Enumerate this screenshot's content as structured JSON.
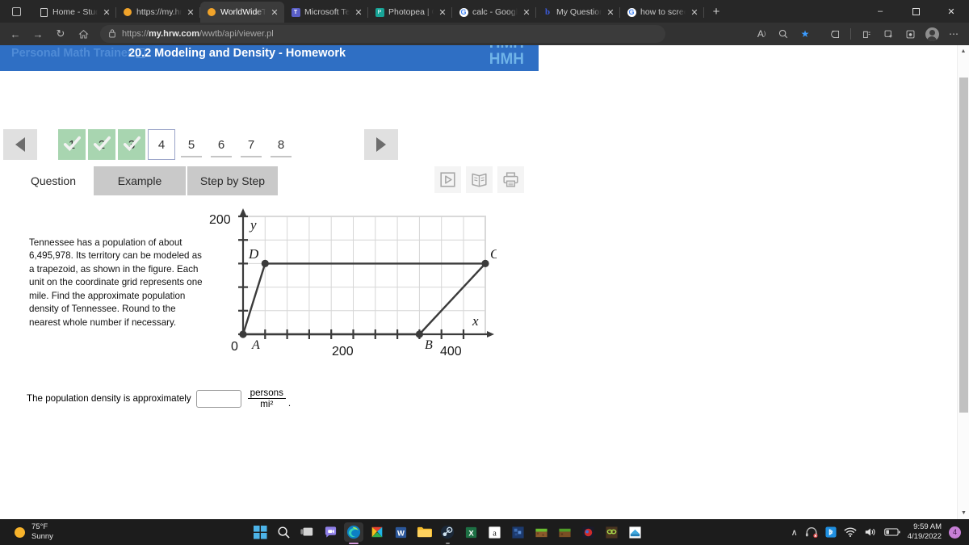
{
  "browser": {
    "tabs": [
      {
        "label": "Home - Student P",
        "icon": "page-icon",
        "active": false
      },
      {
        "label": "https://my.hrw.co",
        "icon": "orange-dot-icon",
        "active": false
      },
      {
        "label": "WorldWideTestba",
        "icon": "orange-dot-icon",
        "active": true
      },
      {
        "label": "Microsoft Teams",
        "icon": "teams-icon",
        "active": false
      },
      {
        "label": "Photopea | Online",
        "icon": "photopea-icon",
        "active": false
      },
      {
        "label": "calc - Google Sea",
        "icon": "google-icon",
        "active": false
      },
      {
        "label": "My Questions | ba",
        "icon": "brainly-icon",
        "active": false
      },
      {
        "label": "how to screensho",
        "icon": "google-icon",
        "active": false
      }
    ],
    "new_tab_label": "+",
    "window_controls": {
      "minimize": "–",
      "maximize": "❐",
      "close": "✕"
    },
    "nav": {
      "back": "←",
      "forward": "→",
      "refresh": "↻",
      "home": "⌂",
      "lock_icon": "lock-icon"
    },
    "url": {
      "prefix": "https://",
      "domain": "my.hrw.com",
      "path": "/wwtb/api/viewer.pl",
      "full": "https://my.hrw.com/wwtb/api/viewer.pl"
    },
    "toolbar_right": [
      "read-aloud-icon",
      "zoom-icon",
      "favorite-star-icon",
      "split-screen-icon",
      "collections-icon",
      "add-to-collections-icon",
      "browser-essentials-icon",
      "profile-avatar",
      "settings-more-icon"
    ]
  },
  "app": {
    "brand_left": "Personal Math Trainer",
    "title": "20.2 Modeling and Density - Homework",
    "logo_top": "HMH",
    "logo": "HMH"
  },
  "pager": {
    "prev_label": "◀",
    "next_label": "▶",
    "questions": [
      {
        "num": "1",
        "state": "done"
      },
      {
        "num": "2",
        "state": "done"
      },
      {
        "num": "3",
        "state": "done"
      },
      {
        "num": "4",
        "state": "current"
      },
      {
        "num": "5",
        "state": "plain"
      },
      {
        "num": "6",
        "state": "plain"
      },
      {
        "num": "7",
        "state": "plain"
      },
      {
        "num": "8",
        "state": "plain"
      }
    ]
  },
  "tabs": {
    "question": "Question",
    "example": "Example",
    "step_by_step": "Step by Step"
  },
  "tools": {
    "video": "video-play-icon",
    "textbook": "textbook-icon",
    "print": "printer-icon"
  },
  "problem": {
    "text": "Tennessee has a population of about 6,495,978. Its territory can be modeled as a trapezoid, as shown in the figure. Each unit on the coordinate grid represents one mile. Find the approximate population density of Tennessee. Round to the nearest whole number if necessary."
  },
  "answer": {
    "prompt": "The population density is approximately",
    "value": "",
    "placeholder": "",
    "unit_numerator": "persons",
    "unit_denominator": "mi²",
    "period": "."
  },
  "chart_data": {
    "type": "scatter",
    "title": "",
    "xlabel": "x",
    "ylabel": "y",
    "xlim": [
      0,
      440
    ],
    "ylim": [
      0,
      200
    ],
    "grid": true,
    "x_ticks": [
      0,
      40,
      80,
      120,
      160,
      200,
      240,
      280,
      320,
      360,
      400,
      440
    ],
    "y_ticks": [
      0,
      40,
      80,
      120,
      160,
      200
    ],
    "x_tick_labels": [
      {
        "value": 0,
        "label": "0"
      },
      {
        "value": 200,
        "label": "200"
      },
      {
        "value": 400,
        "label": "400"
      }
    ],
    "y_tick_labels": [
      {
        "value": 200,
        "label": "200"
      }
    ],
    "points": [
      {
        "name": "A",
        "x": 0,
        "y": 0,
        "label_pos": "below-right"
      },
      {
        "name": "B",
        "x": 320,
        "y": 0,
        "label_pos": "below-right"
      },
      {
        "name": "C",
        "x": 440,
        "y": 120,
        "label_pos": "above-right"
      },
      {
        "name": "D",
        "x": 40,
        "y": 120,
        "label_pos": "above-left"
      }
    ],
    "shape": "trapezoid",
    "edges": [
      [
        "A",
        "D"
      ],
      [
        "D",
        "C"
      ],
      [
        "C",
        "B"
      ],
      [
        "B",
        "A"
      ]
    ],
    "origin_label": "0",
    "annotations": [
      "A",
      "B",
      "C",
      "D",
      "x",
      "y",
      "0",
      "200",
      "400",
      "200"
    ]
  },
  "taskbar": {
    "weather": {
      "temp": "75°F",
      "condition": "Sunny",
      "icon": "sun-icon"
    },
    "apps": [
      {
        "name": "start-button",
        "icon": "windows-logo-icon"
      },
      {
        "name": "search-button",
        "icon": "search-icon"
      },
      {
        "name": "task-view-button",
        "icon": "task-view-icon"
      },
      {
        "name": "chat-button",
        "icon": "teams-chat-icon"
      },
      {
        "name": "edge-button",
        "icon": "edge-icon"
      },
      {
        "name": "photos-button",
        "icon": "photos-icon"
      },
      {
        "name": "word-button",
        "icon": "word-icon"
      },
      {
        "name": "file-explorer-button",
        "icon": "folder-icon"
      },
      {
        "name": "steam-button",
        "icon": "steam-icon"
      },
      {
        "name": "excel-button",
        "icon": "excel-icon"
      },
      {
        "name": "amazon-button",
        "icon": "amazon-icon"
      },
      {
        "name": "minecraft-launcher-button",
        "icon": "minecraft-portal-icon"
      },
      {
        "name": "minecraft-button",
        "icon": "grass-block-icon"
      },
      {
        "name": "minecraft-2-button",
        "icon": "grass-block-icon"
      },
      {
        "name": "badlion-button",
        "icon": "badlion-icon"
      },
      {
        "name": "lunar-client-button",
        "icon": "lunar-icon"
      },
      {
        "name": "bluestacks-button",
        "icon": "bluestacks-icon"
      }
    ],
    "tray": {
      "chevron": "∧",
      "icons": [
        "headset-muted-icon",
        "bluetooth-icon",
        "wifi-icon",
        "volume-icon",
        "battery-icon"
      ],
      "time": "9:59 AM",
      "date": "4/19/2022",
      "notification_count": "4"
    }
  }
}
